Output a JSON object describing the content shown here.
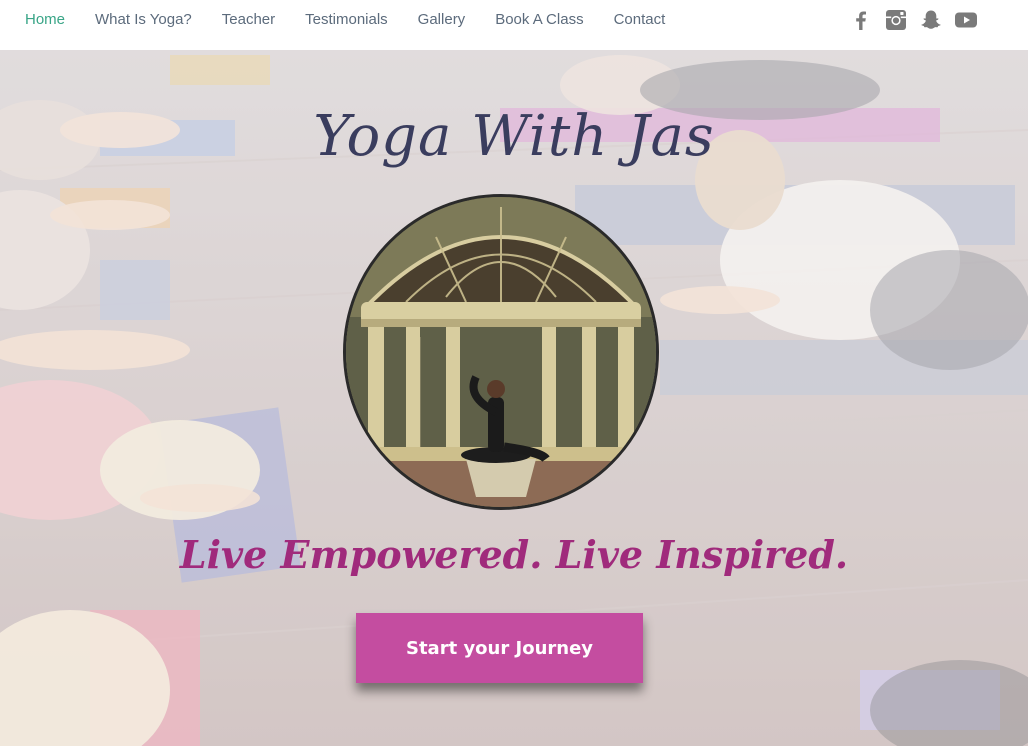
{
  "nav": {
    "items": [
      {
        "label": "Home",
        "active": true
      },
      {
        "label": "What Is Yoga?"
      },
      {
        "label": "Teacher"
      },
      {
        "label": "Testimonials"
      },
      {
        "label": "Gallery"
      },
      {
        "label": "Book A Class"
      },
      {
        "label": "Contact"
      }
    ],
    "active_color": "#39a587",
    "text_color": "#5c6b7c"
  },
  "social": {
    "icons": [
      "facebook-icon",
      "instagram-icon",
      "snapchat-icon",
      "youtube-icon"
    ],
    "color": "#7a7a7a"
  },
  "hero": {
    "title": "Yoga With Jas",
    "tagline": "Live Empowered. Live Inspired.",
    "cta_label": "Start your Journey",
    "title_color": "#3a3d5e",
    "tagline_color": "#a02a7c",
    "cta_color": "#c44da0"
  }
}
